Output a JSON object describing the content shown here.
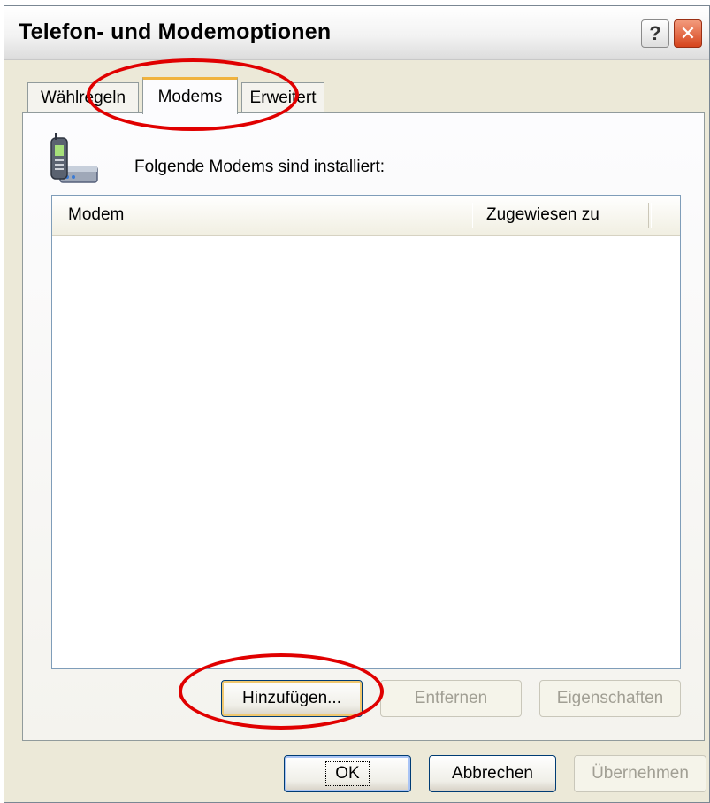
{
  "window": {
    "title": "Telefon- und Modemoptionen",
    "help_glyph": "?",
    "close_glyph": "✕"
  },
  "tabs": [
    {
      "label": "Wählregeln",
      "active": false
    },
    {
      "label": "Modems",
      "active": true
    },
    {
      "label": "Erweitert",
      "active": false
    }
  ],
  "panel": {
    "icon": "phone-modem-icon",
    "intro": "Folgende Modems sind installiert:",
    "list_columns": [
      "Modem",
      "Zugewiesen zu"
    ],
    "rows": [],
    "buttons": {
      "add": {
        "label": "Hinzufügen...",
        "enabled": true
      },
      "remove": {
        "label": "Entfernen",
        "enabled": false
      },
      "properties": {
        "label": "Eigenschaften",
        "enabled": false
      }
    }
  },
  "dialog_buttons": {
    "ok": {
      "label": "OK",
      "enabled": true
    },
    "cancel": {
      "label": "Abbrechen",
      "enabled": true
    },
    "apply": {
      "label": "Übernehmen",
      "enabled": false
    }
  },
  "annotation_color": "#e00000"
}
